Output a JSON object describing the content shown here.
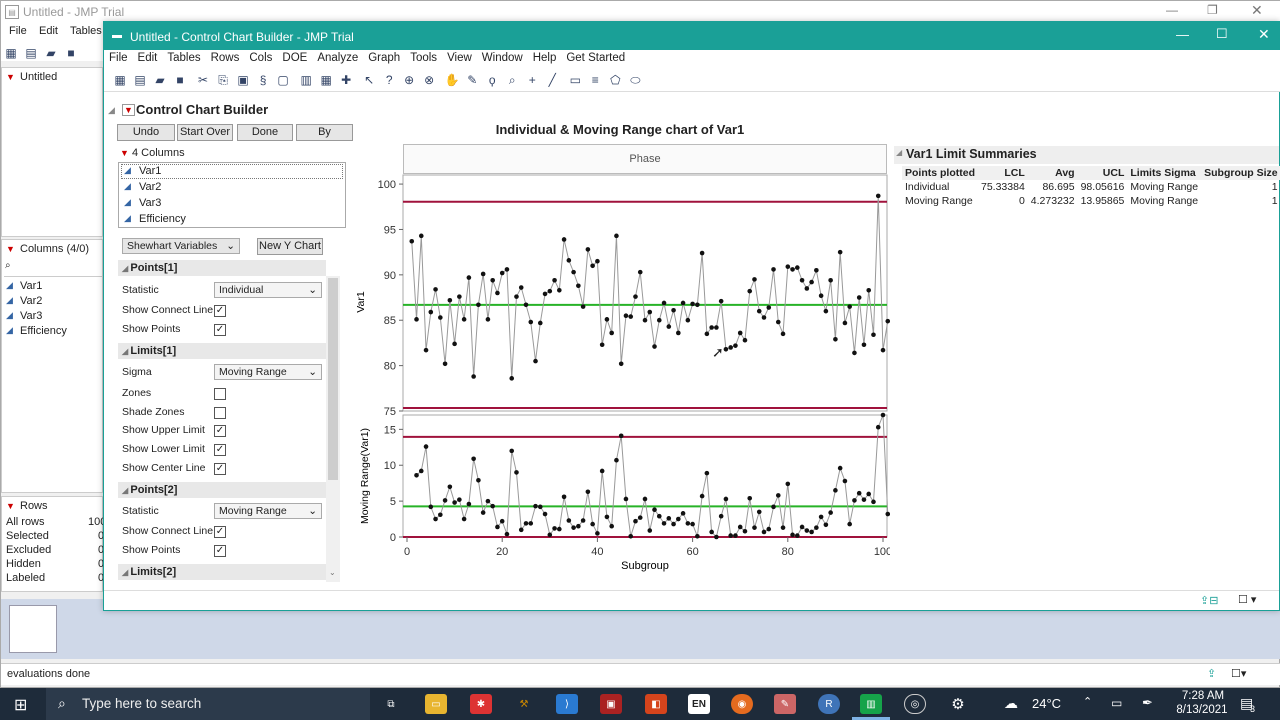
{
  "bg": {
    "title": "Untitled - JMP Trial",
    "menu": [
      "File",
      "Edit",
      "Tables"
    ],
    "panel_title": "Untitled",
    "columns_header": "Columns (4/0)",
    "columns": [
      "Var1",
      "Var2",
      "Var3",
      "Efficiency"
    ],
    "rows_header": "Rows",
    "rows": [
      {
        "label": "All rows",
        "value": "100"
      },
      {
        "label": "Selected",
        "value": "0"
      },
      {
        "label": "Excluded",
        "value": "0"
      },
      {
        "label": "Hidden",
        "value": "0"
      },
      {
        "label": "Labeled",
        "value": "0"
      }
    ],
    "status": "evaluations done"
  },
  "win": {
    "title": "Untitled - Control Chart Builder - JMP Trial",
    "menu": [
      "File",
      "Edit",
      "Tables",
      "Rows",
      "Cols",
      "DOE",
      "Analyze",
      "Graph",
      "Tools",
      "View",
      "Window",
      "Help",
      "Get Started"
    ]
  },
  "ccb": {
    "title": "Control Chart Builder",
    "buttons": {
      "undo": "Undo",
      "start_over": "Start Over",
      "done": "Done",
      "by": "By"
    },
    "columns_header": "4 Columns",
    "columns": [
      "Var1",
      "Var2",
      "Var3",
      "Efficiency"
    ],
    "shewhart": "Shewhart Variables",
    "new_y": "New Y Chart",
    "points1": {
      "title": "Points[1]",
      "statistic_label": "Statistic",
      "statistic": "Individual",
      "connect": "Show Connect Line",
      "points": "Show Points"
    },
    "limits1": {
      "title": "Limits[1]",
      "sigma_label": "Sigma",
      "sigma": "Moving Range",
      "zones": "Zones",
      "shade": "Shade Zones",
      "upper": "Show Upper Limit",
      "lower": "Show Lower Limit",
      "center": "Show Center Line"
    },
    "points2": {
      "title": "Points[2]",
      "statistic_label": "Statistic",
      "statistic": "Moving Range",
      "connect": "Show Connect Line",
      "points": "Show Points"
    },
    "limits2": {
      "title": "Limits[2]"
    }
  },
  "chart_data": {
    "type": "line",
    "title": "Individual & Moving Range chart of Var1",
    "phase_label": "Phase",
    "xlabel": "Subgroup",
    "x_ticks": [
      "0",
      "20",
      "40",
      "60",
      "80",
      "100"
    ],
    "individual": {
      "ylabel": "Var1",
      "y_ticks": [
        "75",
        "80",
        "85",
        "90",
        "95",
        "100"
      ],
      "ylim": [
        75,
        101
      ],
      "lcl": 75.33384,
      "avg": 86.695,
      "ucl": 98.05616,
      "values": [
        93.7,
        85.1,
        94.3,
        81.7,
        85.9,
        88.4,
        85.3,
        80.2,
        87.2,
        82.4,
        87.6,
        85.1,
        89.7,
        78.8,
        86.7,
        90.1,
        85.1,
        89.4,
        88.0,
        90.2,
        90.6,
        78.6,
        87.6,
        88.6,
        86.7,
        84.8,
        80.5,
        84.7,
        87.9,
        88.2,
        89.4,
        88.3,
        93.9,
        91.6,
        90.3,
        88.8,
        86.5,
        92.8,
        91.0,
        91.5,
        82.3,
        85.1,
        83.6,
        94.3,
        80.2,
        85.5,
        85.4,
        87.6,
        90.3,
        85.0,
        85.9,
        82.1,
        85.0,
        86.9,
        84.3,
        86.1,
        83.6,
        86.9,
        85.0,
        86.8,
        86.7,
        92.4,
        83.5,
        84.2,
        84.2,
        87.1,
        81.8,
        82.0,
        82.2,
        83.6,
        82.8,
        88.2,
        89.5,
        86.0,
        85.3,
        86.4,
        90.6,
        84.8,
        83.5,
        90.9,
        90.6,
        90.8,
        89.4,
        88.5,
        89.2,
        90.5,
        87.7,
        86.0,
        89.4,
        82.9,
        92.5,
        84.7,
        86.5,
        81.4,
        87.5,
        82.3,
        88.3,
        83.4,
        98.7,
        81.7,
        84.9
      ]
    },
    "moving_range": {
      "ylabel": "Moving Range(Var1)",
      "y_ticks": [
        "0",
        "5",
        "10",
        "15"
      ],
      "ylim": [
        0,
        17
      ],
      "lcl": 0,
      "avg": 4.273232,
      "ucl": 13.95865,
      "values": [
        null,
        8.6,
        9.2,
        12.6,
        4.2,
        2.5,
        3.1,
        5.1,
        7.0,
        4.8,
        5.2,
        2.5,
        4.6,
        10.9,
        7.9,
        3.4,
        5.0,
        4.3,
        1.4,
        2.2,
        0.4,
        12.0,
        9.0,
        1.0,
        1.9,
        1.9,
        4.3,
        4.2,
        3.2,
        0.3,
        1.2,
        1.1,
        5.6,
        2.3,
        1.3,
        1.5,
        2.3,
        6.3,
        1.8,
        0.5,
        9.2,
        2.8,
        1.5,
        10.7,
        14.1,
        5.3,
        0.1,
        2.2,
        2.7,
        5.3,
        0.9,
        3.8,
        2.9,
        1.9,
        2.6,
        1.8,
        2.5,
        3.3,
        1.9,
        1.8,
        0.1,
        5.7,
        8.9,
        0.7,
        0.0,
        2.9,
        5.3,
        0.2,
        0.2,
        1.4,
        0.8,
        5.4,
        1.3,
        3.5,
        0.7,
        1.1,
        4.2,
        5.8,
        1.3,
        7.4,
        0.3,
        0.2,
        1.4,
        0.9,
        0.7,
        1.3,
        2.8,
        1.7,
        3.4,
        6.5,
        9.6,
        7.8,
        1.8,
        5.1,
        6.1,
        5.2,
        6.0,
        4.9,
        15.3,
        17.0,
        3.2
      ]
    }
  },
  "limits": {
    "title": "Var1 Limit Summaries",
    "headers": [
      "Points plotted",
      "LCL",
      "Avg",
      "UCL",
      "Limits Sigma",
      "Subgroup Size"
    ],
    "rows": [
      [
        "Individual",
        "75.33384",
        "86.695",
        "98.05616",
        "Moving Range",
        "1"
      ],
      [
        "Moving Range",
        "0",
        "4.273232",
        "13.95865",
        "Moving Range",
        "1"
      ]
    ]
  },
  "taskbar": {
    "search": "Type here to search",
    "weather": "24°C",
    "time": "7:28 AM",
    "date": "8/13/2021",
    "notif": "3",
    "lang": "EN"
  },
  "colors": {
    "accent": "#1aa097",
    "limit": "#a0123c",
    "center": "#27b327"
  }
}
